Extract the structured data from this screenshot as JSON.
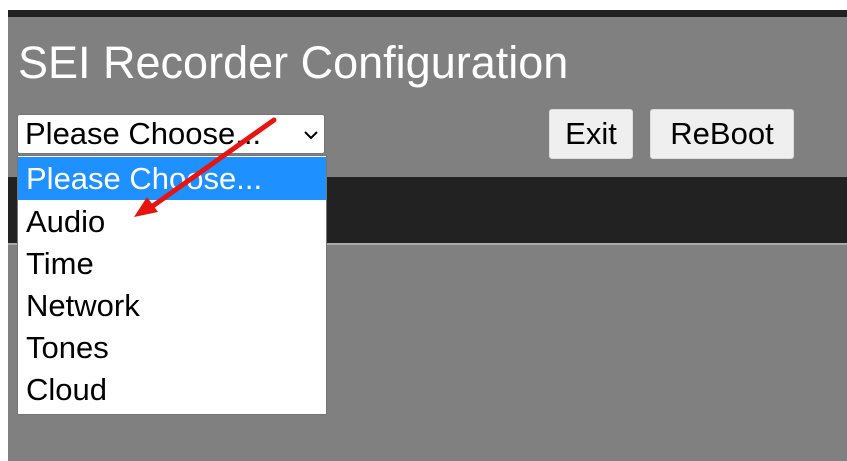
{
  "page": {
    "title": "SEI Recorder Configuration"
  },
  "menu_select": {
    "selected_value": "Please Choose...",
    "options": [
      {
        "label": "Please Choose...",
        "highlighted": true
      },
      {
        "label": "Audio",
        "highlighted": false
      },
      {
        "label": "Time",
        "highlighted": false
      },
      {
        "label": "Network",
        "highlighted": false
      },
      {
        "label": "Tones",
        "highlighted": false
      },
      {
        "label": "Cloud",
        "highlighted": false
      }
    ]
  },
  "buttons": {
    "exit_label": "Exit",
    "reboot_label": "ReBoot"
  },
  "annotation": {
    "arrow_color": "#e8140f",
    "points_to": "Audio"
  },
  "colors": {
    "page_background": "#808080",
    "dark_band": "#222222",
    "option_highlight": "#1e90ff",
    "title_text": "#ffffff"
  }
}
